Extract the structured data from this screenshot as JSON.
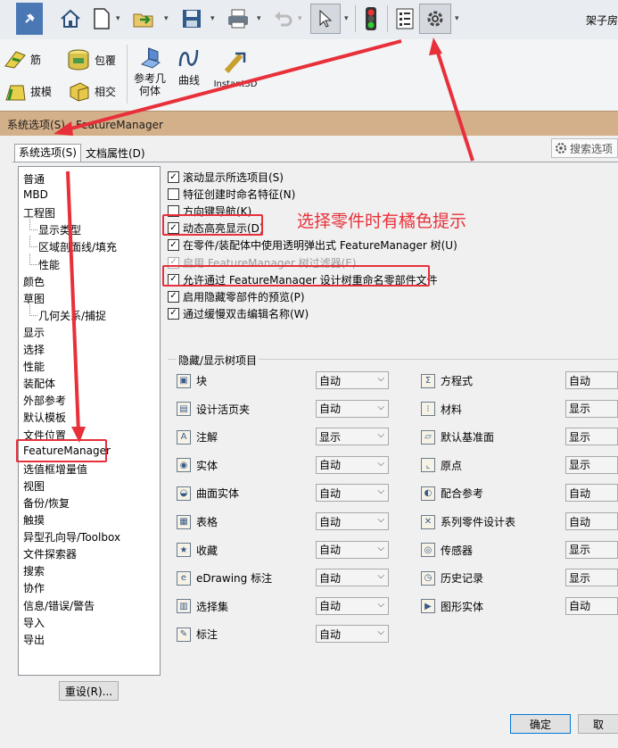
{
  "toolbar": {
    "right_text": "架子房",
    "icons": [
      "pin-icon",
      "home-icon",
      "new-document-icon",
      "open-icon",
      "save-icon",
      "print-icon",
      "undo-icon",
      "select-arrow-icon",
      "traffic-light-icon",
      "file-properties-icon",
      "options-gear-icon"
    ]
  },
  "ribbon": {
    "rib": "筋",
    "wrap": "包覆",
    "draft": "拔模",
    "intersect": "相交",
    "ref_geom": "参考几\n何体",
    "curves": "曲线",
    "instant3d": "Instant3D"
  },
  "dialog": {
    "title": "系统选项(S) - FeatureManager",
    "tab_system": "系统选项(S)",
    "tab_doc": "文档属性(D)",
    "search": "搜索选项",
    "reset": "重设(R)...",
    "ok": "确定",
    "cancel": "取"
  },
  "tree": [
    {
      "label": "普通",
      "sub": false
    },
    {
      "label": "MBD",
      "sub": false
    },
    {
      "label": "工程图",
      "sub": false
    },
    {
      "label": "显示类型",
      "sub": true
    },
    {
      "label": "区域剖面线/填充",
      "sub": true
    },
    {
      "label": "性能",
      "sub": true
    },
    {
      "label": "颜色",
      "sub": false
    },
    {
      "label": "草图",
      "sub": false
    },
    {
      "label": "几何关系/捕捉",
      "sub": true
    },
    {
      "label": "显示",
      "sub": false
    },
    {
      "label": "选择",
      "sub": false
    },
    {
      "label": "性能",
      "sub": false
    },
    {
      "label": "装配体",
      "sub": false
    },
    {
      "label": "外部参考",
      "sub": false
    },
    {
      "label": "默认模板",
      "sub": false
    },
    {
      "label": "文件位置",
      "sub": false
    },
    {
      "label": "FeatureManager",
      "sub": false
    },
    {
      "label": "选值框增量值",
      "sub": false
    },
    {
      "label": "视图",
      "sub": false
    },
    {
      "label": "备份/恢复",
      "sub": false
    },
    {
      "label": "触摸",
      "sub": false
    },
    {
      "label": "异型孔向导/Toolbox",
      "sub": false
    },
    {
      "label": "文件探索器",
      "sub": false
    },
    {
      "label": "搜索",
      "sub": false
    },
    {
      "label": "协作",
      "sub": false
    },
    {
      "label": "信息/错误/警告",
      "sub": false
    },
    {
      "label": "导入",
      "sub": false
    },
    {
      "label": "导出",
      "sub": false
    }
  ],
  "options": [
    {
      "label": "滚动显示所选项目(S)",
      "checked": true,
      "disabled": false
    },
    {
      "label": "特征创建时命名特征(N)",
      "checked": false,
      "disabled": false
    },
    {
      "label": "方向键导航(K)",
      "checked": false,
      "disabled": false
    },
    {
      "label": "动态高亮显示(D)",
      "checked": true,
      "disabled": false
    },
    {
      "label": "在零件/装配体中使用透明弹出式 FeatureManager 树(U)",
      "checked": true,
      "disabled": false
    },
    {
      "label": "启用 FeatureManager 树过滤器(E)",
      "checked": true,
      "disabled": true
    },
    {
      "label": "允许通过 FeatureManager 设计树重命名零部件文件",
      "checked": true,
      "disabled": false
    },
    {
      "label": "启用隐藏零部件的预览(P)",
      "checked": true,
      "disabled": false
    },
    {
      "label": "通过缓慢双击编辑名称(W)",
      "checked": true,
      "disabled": false
    }
  ],
  "annotation": "选择零件时有橘色提示",
  "group_label": "隐藏/显示树项目",
  "left_items": [
    {
      "label": "块",
      "value": "自动",
      "icon": "block-icon"
    },
    {
      "label": "设计活页夹",
      "value": "自动",
      "icon": "design-binder-icon"
    },
    {
      "label": "注解",
      "value": "显示",
      "icon": "annotations-icon"
    },
    {
      "label": "实体",
      "value": "自动",
      "icon": "solid-bodies-icon"
    },
    {
      "label": "曲面实体",
      "value": "自动",
      "icon": "surface-bodies-icon"
    },
    {
      "label": "表格",
      "value": "自动",
      "icon": "tables-icon"
    },
    {
      "label": "收藏",
      "value": "自动",
      "icon": "favorites-icon"
    },
    {
      "label": "eDrawing 标注",
      "value": "自动",
      "icon": "edrawing-markup-icon"
    },
    {
      "label": "选择集",
      "value": "自动",
      "icon": "selection-sets-icon"
    },
    {
      "label": "标注",
      "value": "自动",
      "icon": "markup-icon"
    }
  ],
  "right_items": [
    {
      "label": "方程式",
      "value": "自动",
      "icon": "equations-icon"
    },
    {
      "label": "材料",
      "value": "显示",
      "icon": "material-icon"
    },
    {
      "label": "默认基准面",
      "value": "显示",
      "icon": "default-planes-icon"
    },
    {
      "label": "原点",
      "value": "显示",
      "icon": "origin-icon"
    },
    {
      "label": "配合参考",
      "value": "自动",
      "icon": "mate-references-icon"
    },
    {
      "label": "系列零件设计表",
      "value": "自动",
      "icon": "design-table-icon"
    },
    {
      "label": "传感器",
      "value": "显示",
      "icon": "sensors-icon"
    },
    {
      "label": "历史记录",
      "value": "显示",
      "icon": "history-icon"
    },
    {
      "label": "图形实体",
      "value": "自动",
      "icon": "graphic-bodies-icon"
    }
  ],
  "colors": {
    "accent": "#e8303a",
    "titlebar": "#d4b08a"
  }
}
